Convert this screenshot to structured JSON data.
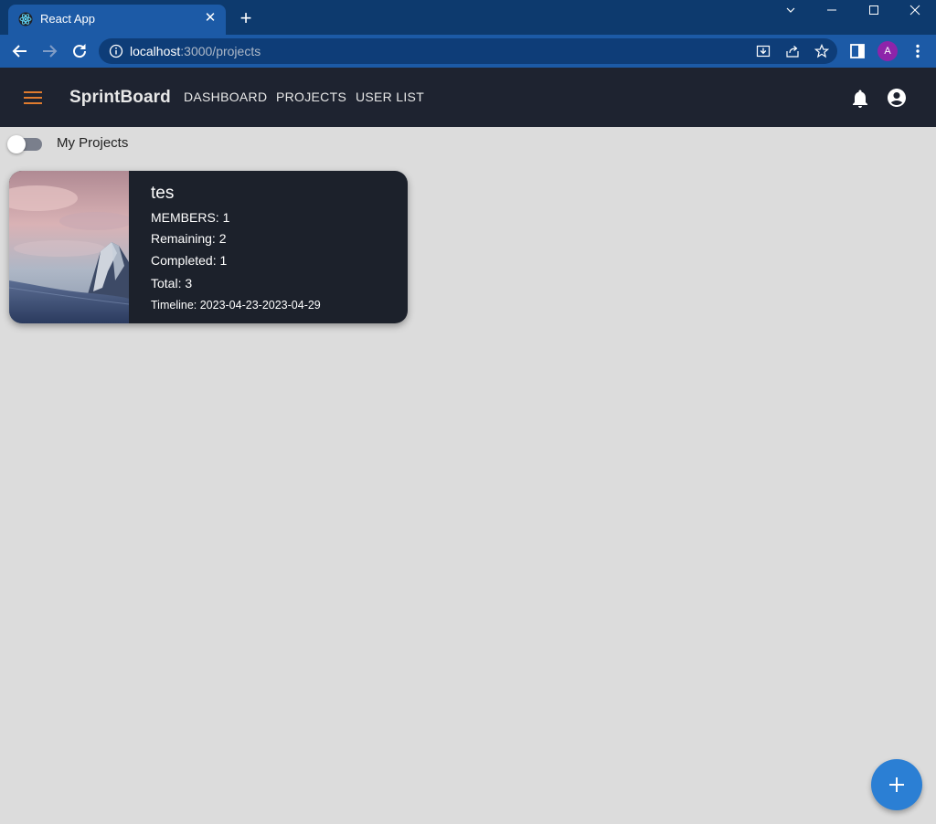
{
  "browser": {
    "tab_title": "React App",
    "url_host": "localhost",
    "url_rest": ":3000/projects",
    "profile_initial": "A",
    "colors": {
      "tabstrip": "#0d3a6e",
      "toolbar": "#1c5aa6",
      "profile": "#8e24aa"
    }
  },
  "appbar": {
    "brand": "SprintBoard",
    "nav": [
      "DASHBOARD",
      "PROJECTS",
      "USER LIST"
    ],
    "icons": [
      "menu-icon",
      "bell-icon",
      "account-circle-icon"
    ],
    "colors": {
      "background": "#1e2330",
      "menu_icon": "#e07b2e"
    }
  },
  "filters": {
    "my_projects_label": "My Projects",
    "my_projects_on": false
  },
  "projects": [
    {
      "name": "tes",
      "members": "MEMBERS: 1",
      "remaining": "Remaining: 2",
      "completed": "Completed: 1",
      "total": "Total: 3",
      "timeline": "Timeline: 2023-04-23-2023-04-29"
    }
  ],
  "fab": {
    "icon": "plus-icon",
    "color": "#2b7fd4"
  }
}
